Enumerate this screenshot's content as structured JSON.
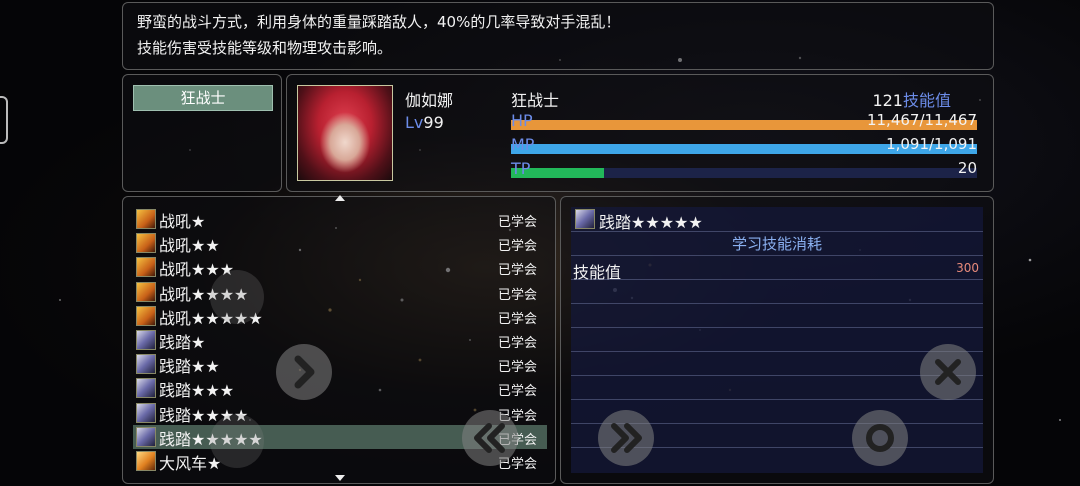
{
  "description": {
    "line1": "野蛮的战斗方式，利用身体的重量踩踏敌人，40%的几率导致对手混乱！",
    "line2": "技能伤害受技能等级和物理攻击影响。"
  },
  "class_tag": "狂战士",
  "character": {
    "name": "伽如娜",
    "level_prefix": "Lv",
    "level": "99",
    "class": "狂战士",
    "skill_points": "121",
    "skill_points_label": "技能值"
  },
  "bars": [
    {
      "label": "HP",
      "value": "11,467/11,467",
      "fill": 1.0,
      "color": "#e8963a"
    },
    {
      "label": "MP",
      "value": "1,091/1,091",
      "fill": 1.0,
      "color": "#3ea6e8"
    },
    {
      "label": "TP",
      "value": "20",
      "fill": 0.2,
      "color": "#22b85a"
    }
  ],
  "skills": [
    {
      "name": "战吼★",
      "status": "已学会",
      "icon": "fire"
    },
    {
      "name": "战吼★★",
      "status": "已学会",
      "icon": "fire"
    },
    {
      "name": "战吼★★★",
      "status": "已学会",
      "icon": "fire"
    },
    {
      "name": "战吼★★★★",
      "status": "已学会",
      "icon": "fire"
    },
    {
      "name": "战吼★★★★★",
      "status": "已学会",
      "icon": "fire"
    },
    {
      "name": "践踏★",
      "status": "已学会",
      "icon": "stomp"
    },
    {
      "name": "践踏★★",
      "status": "已学会",
      "icon": "stomp"
    },
    {
      "name": "践踏★★★",
      "status": "已学会",
      "icon": "stomp"
    },
    {
      "name": "践踏★★★★",
      "status": "已学会",
      "icon": "stomp"
    },
    {
      "name": "践踏★★★★★",
      "status": "已学会",
      "icon": "stomp",
      "selected": true
    },
    {
      "name": "大风车★",
      "status": "已学会",
      "icon": "wind"
    }
  ],
  "detail": {
    "title": "践踏★★★★★",
    "cost_heading": "学习技能消耗",
    "cost_label": "技能值",
    "cost_value": "300"
  },
  "controls": [
    "next-arrow",
    "back-double-arrow",
    "close",
    "forward-double-arrow",
    "confirm"
  ]
}
